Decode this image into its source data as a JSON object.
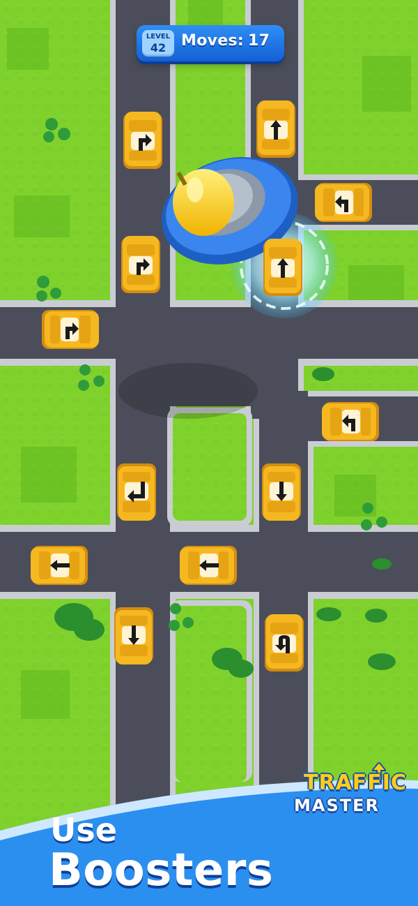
{
  "hud": {
    "level_label": "LEVEL",
    "level_number": "42",
    "moves_label": "Moves:",
    "moves_value": "17"
  },
  "booster": {
    "name": "ufo",
    "colors": {
      "dome": "#ffd21a",
      "ring": "#2f7fe8",
      "beam": "#9fe9ff"
    }
  },
  "cars": [
    {
      "name": "car-top-left",
      "icon": "turn-right-arrow-icon",
      "facing": "up"
    },
    {
      "name": "car-top-middle",
      "icon": "straight-up-arrow-icon",
      "facing": "up"
    },
    {
      "name": "car-right-upper",
      "icon": "turn-left-arrow-icon",
      "facing": "left"
    },
    {
      "name": "car-left-upper",
      "icon": "turn-right-arrow-icon",
      "facing": "up"
    },
    {
      "name": "car-under-beam",
      "icon": "straight-up-arrow-icon",
      "facing": "up"
    },
    {
      "name": "car-left-road",
      "icon": "turn-right-arrow-icon",
      "facing": "right"
    },
    {
      "name": "car-right-middle",
      "icon": "turn-left-arrow-icon",
      "facing": "left"
    },
    {
      "name": "car-mid-left",
      "icon": "turn-left-down-arrow-icon",
      "facing": "down"
    },
    {
      "name": "car-mid-right",
      "icon": "straight-down-arrow-icon",
      "facing": "down"
    },
    {
      "name": "car-bottom-left-h",
      "icon": "straight-left-arrow-icon",
      "facing": "left"
    },
    {
      "name": "car-bottom-mid-h",
      "icon": "straight-left-arrow-icon",
      "facing": "left"
    },
    {
      "name": "car-bottom-left-v",
      "icon": "straight-down-arrow-icon",
      "facing": "down"
    },
    {
      "name": "car-bottom-right-v",
      "icon": "u-turn-arrow-icon",
      "facing": "up"
    }
  ],
  "logo": {
    "line1": "TRAFFIC",
    "line2": "MASTER"
  },
  "caption": {
    "line1": "Use",
    "line2": "Boosters"
  },
  "colors": {
    "grass": "#7ccf2a",
    "road": "#4b4e5a",
    "car": "#f3b41d",
    "banner": "#2b8ff0"
  }
}
